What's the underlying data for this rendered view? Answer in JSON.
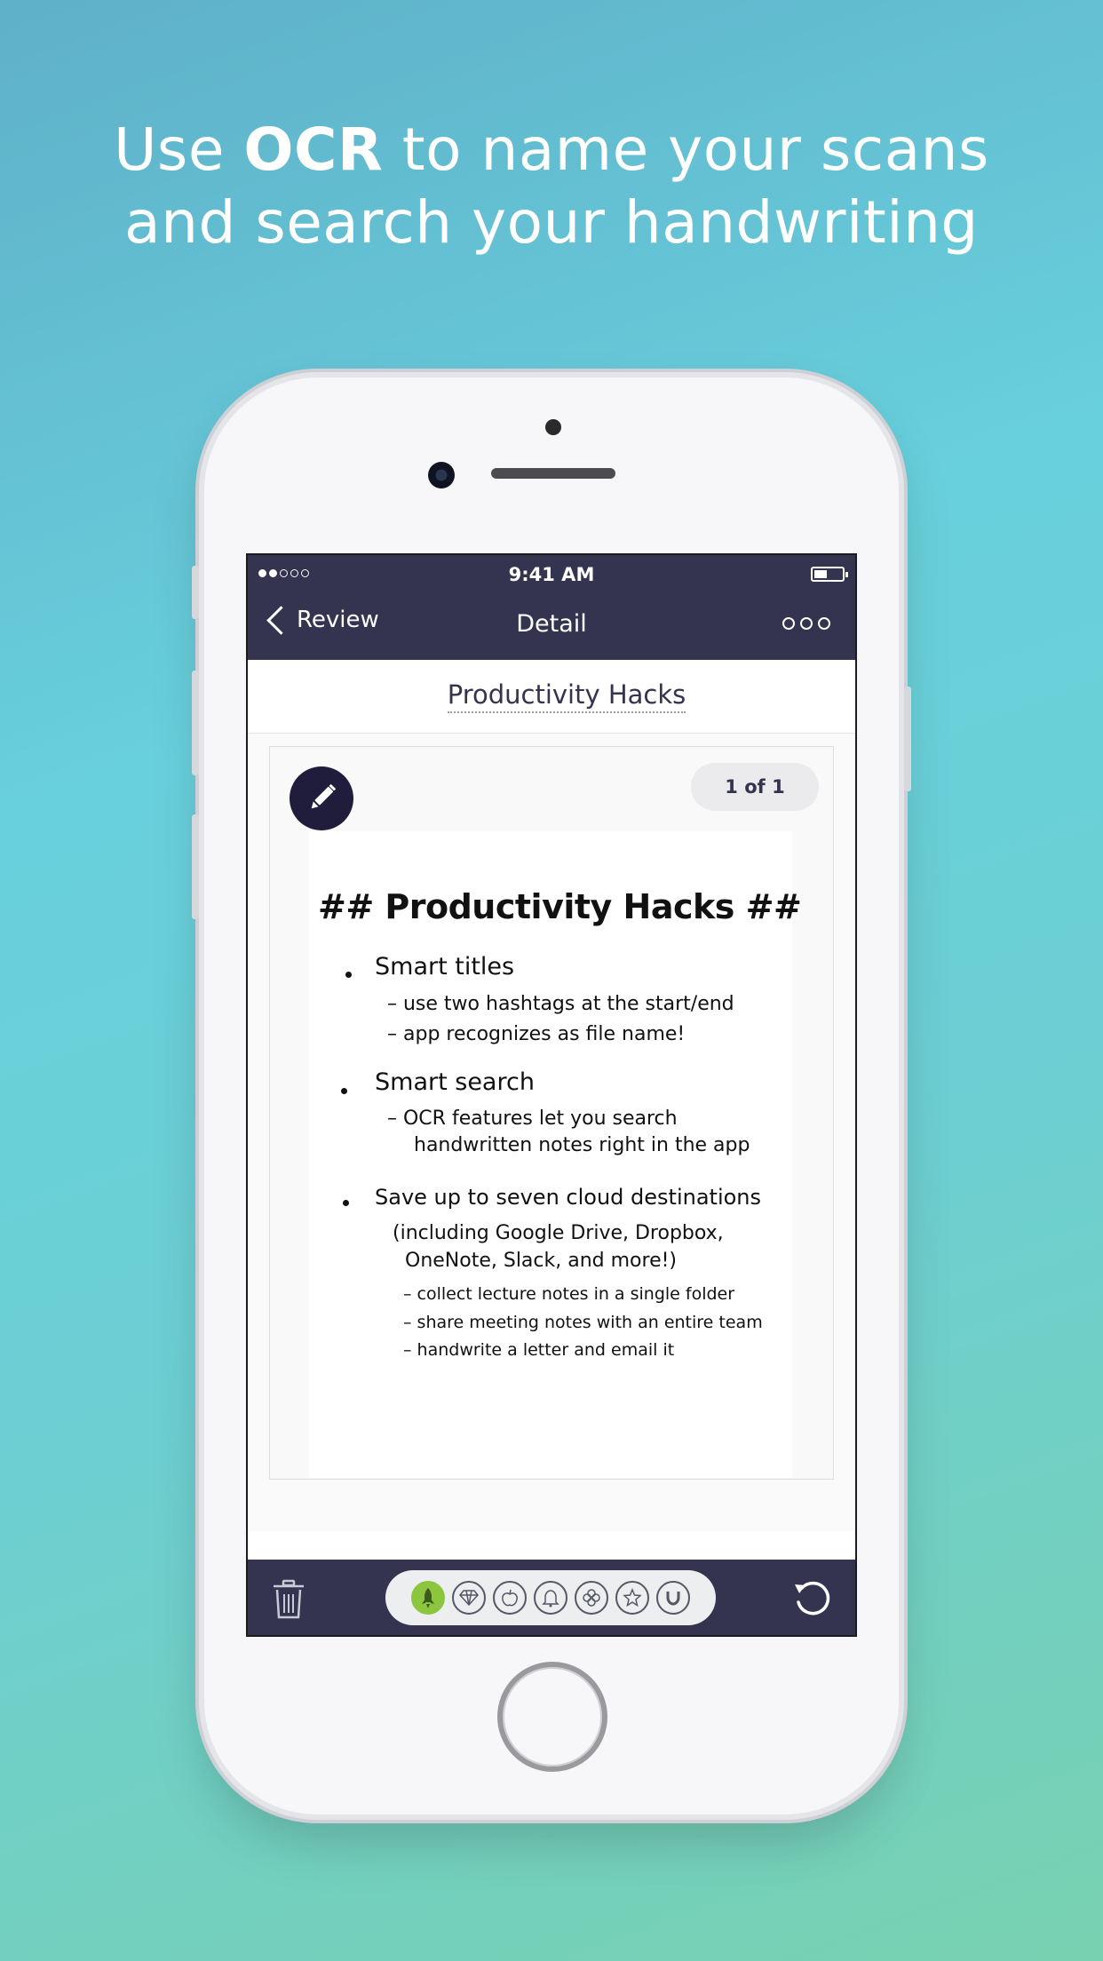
{
  "headline": {
    "line1_pre": "Use ",
    "line1_bold": "OCR",
    "line1_post": " to name your scans",
    "line2": "and search your handwriting"
  },
  "status_bar": {
    "time": "9:41 AM",
    "signal_filled": 2,
    "signal_total": 5
  },
  "nav": {
    "back_label": "Review",
    "title": "Detail",
    "more_icon": "more-horizontal-icon"
  },
  "document": {
    "title": "Productivity Hacks",
    "page_indicator": "1 of 1",
    "edit_icon": "pencil-icon"
  },
  "handwritten_note": {
    "title": "## Productivity Hacks ##",
    "sections": [
      {
        "bullet": "Smart titles",
        "lines": [
          "– use two hashtags at the start/end",
          "– app recognizes as file name!"
        ]
      },
      {
        "bullet": "Smart search",
        "lines": [
          "– OCR features let you search",
          "handwritten notes right in the app"
        ]
      },
      {
        "bullet": "Save up to seven cloud destinations",
        "lines": [
          "(including Google Drive, Dropbox,",
          "OneNote, Slack, and more!)",
          "– collect lecture notes in a single folder",
          "– share meeting notes with an entire team",
          "– handwrite a letter and email it"
        ]
      }
    ]
  },
  "toolbar": {
    "trash_icon": "trash-icon",
    "rotate_icon": "rotate-icon",
    "tags": [
      "rocket-icon",
      "diamond-icon",
      "apple-icon",
      "bell-icon",
      "clover-icon",
      "star-icon",
      "horseshoe-icon"
    ],
    "active_tag": "rocket-icon",
    "active_color": "#8cc63f"
  },
  "colors": {
    "bar": "#343350",
    "edit_button": "#1f1d3b"
  }
}
